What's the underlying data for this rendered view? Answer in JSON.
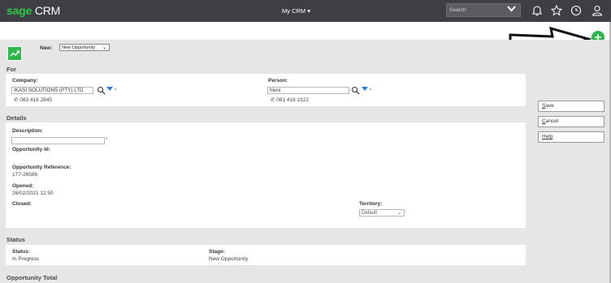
{
  "topbar": {
    "brand": "sage",
    "product": " CRM",
    "menu_label": "My CRM ▾",
    "search_placeholder": "Search",
    "icons": [
      "chevron-down-icon",
      "bell-icon",
      "star-icon",
      "clock-icon",
      "user-icon"
    ]
  },
  "new_bar": {
    "label": "New:",
    "selected": "New Opportunity"
  },
  "for_section": {
    "title": "For",
    "company_label": "Company:",
    "company_value": "IKASI SOLUTIONS (PTY) LTD",
    "company_phone": "083 416 2845",
    "person_label": "Person:",
    "person_value": "hloni",
    "person_phone": "081 416 2322"
  },
  "details_section": {
    "title": "Details",
    "description_label": "Description:",
    "description_value": "",
    "required_mark": "*",
    "opportunity_id_label": "Opportunity Id:",
    "reference_label": "Opportunity Reference:",
    "reference_value": "177-26586",
    "opened_label": "Opened:",
    "opened_value": "26/02/2021 12:50",
    "closed_label": "Closed:",
    "territory_label": "Territory:",
    "territory_value": "Default"
  },
  "status_section": {
    "title": "Status",
    "status_label": "Status:",
    "status_value": "In Progress",
    "stage_label": "Stage:",
    "stage_value": "New Opportunity"
  },
  "total_section": {
    "title": "Opportunity Total"
  },
  "actions": {
    "save_first": "S",
    "save_rest": "ave",
    "cancel_first": "C",
    "cancel_rest": "ancel",
    "help_first": "",
    "help_rest": "Help"
  },
  "colors": {
    "topbar": "#3d3f44",
    "brand_green": "#2fc64b",
    "canvas": "#e6e6e7",
    "accent_blue": "#2a7fdd"
  }
}
